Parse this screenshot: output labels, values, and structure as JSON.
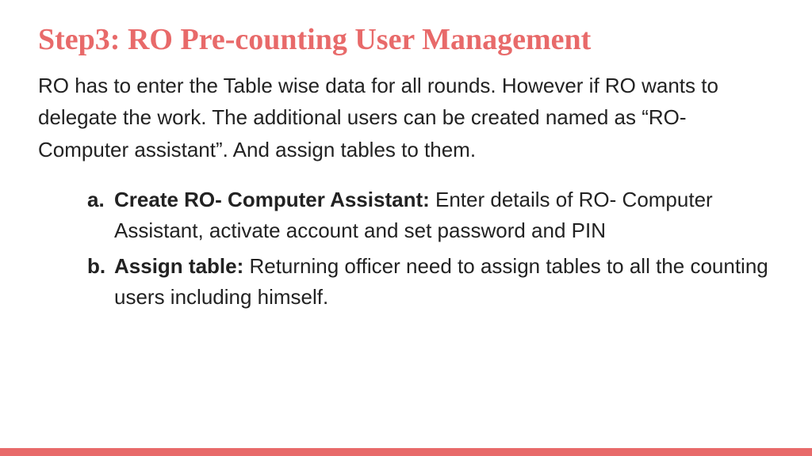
{
  "heading": "Step3: RO Pre-counting User Management",
  "intro": "RO has to enter the Table wise data for all rounds. However if RO wants to delegate the work. The additional users can be created named as “RO- Computer assistant”. And assign tables to them.",
  "items": [
    {
      "marker": "a.",
      "title": "Create RO- Computer Assistant:",
      "body": "  Enter details of RO- Computer Assistant, activate account and set password and PIN"
    },
    {
      "marker": "b.",
      "title": "Assign table:",
      "body": " Returning officer need to assign tables to all the counting users including himself."
    }
  ]
}
